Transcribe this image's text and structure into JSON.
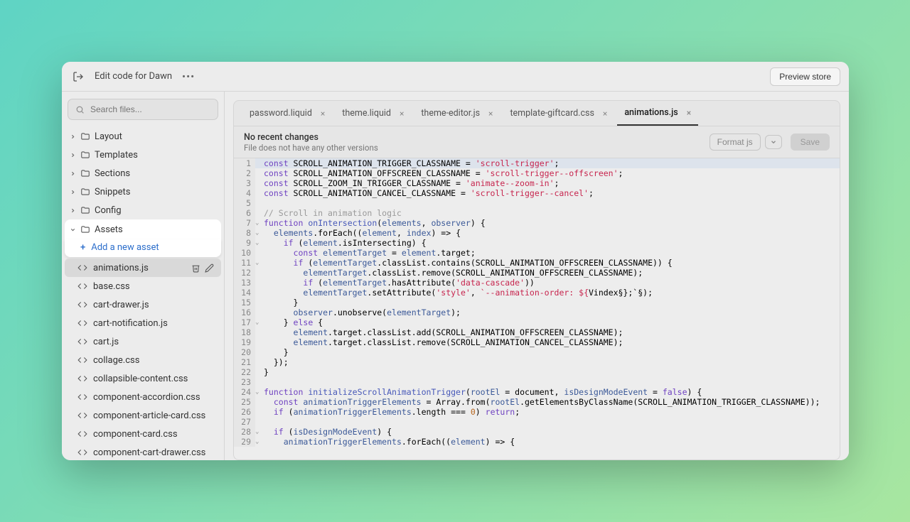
{
  "header": {
    "title": "Edit code for Dawn",
    "preview_label": "Preview store"
  },
  "search": {
    "placeholder": "Search files..."
  },
  "sidebar": {
    "folders": [
      {
        "name": "Layout",
        "expanded": false
      },
      {
        "name": "Templates",
        "expanded": false
      },
      {
        "name": "Sections",
        "expanded": false
      },
      {
        "name": "Snippets",
        "expanded": false
      },
      {
        "name": "Config",
        "expanded": false
      }
    ],
    "assets_label": "Assets",
    "add_asset_label": "Add a new asset",
    "files": [
      {
        "name": "animations.js",
        "selected": true
      },
      {
        "name": "base.css"
      },
      {
        "name": "cart-drawer.js"
      },
      {
        "name": "cart-notification.js"
      },
      {
        "name": "cart.js"
      },
      {
        "name": "collage.css"
      },
      {
        "name": "collapsible-content.css"
      },
      {
        "name": "component-accordion.css"
      },
      {
        "name": "component-article-card.css"
      },
      {
        "name": "component-card.css"
      },
      {
        "name": "component-cart-drawer.css"
      }
    ]
  },
  "tabs": [
    {
      "label": "password.liquid"
    },
    {
      "label": "theme.liquid"
    },
    {
      "label": "theme-editor.js"
    },
    {
      "label": "template-giftcard.css"
    },
    {
      "label": "animations.js",
      "active": true
    }
  ],
  "status": {
    "title": "No recent changes",
    "sub": "File does not have any other versions",
    "format_label": "Format js",
    "save_label": "Save"
  },
  "chart_data": {
    "type": "code",
    "language": "javascript",
    "lines": [
      "const SCROLL_ANIMATION_TRIGGER_CLASSNAME = 'scroll-trigger';",
      "const SCROLL_ANIMATION_OFFSCREEN_CLASSNAME = 'scroll-trigger--offscreen';",
      "const SCROLL_ZOOM_IN_TRIGGER_CLASSNAME = 'animate--zoom-in';",
      "const SCROLL_ANIMATION_CANCEL_CLASSNAME = 'scroll-trigger--cancel';",
      "",
      "// Scroll in animation logic",
      "function onIntersection(elements, observer) {",
      "  elements.forEach((element, index) => {",
      "    if (element.isIntersecting) {",
      "      const elementTarget = element.target;",
      "      if (elementTarget.classList.contains(SCROLL_ANIMATION_OFFSCREEN_CLASSNAME)) {",
      "        elementTarget.classList.remove(SCROLL_ANIMATION_OFFSCREEN_CLASSNAME);",
      "        if (elementTarget.hasAttribute('data-cascade'))",
      "        elementTarget.setAttribute('style', `--animation-order: ${index};`);",
      "      }",
      "      observer.unobserve(elementTarget);",
      "    } else {",
      "      element.target.classList.add(SCROLL_ANIMATION_OFFSCREEN_CLASSNAME);",
      "      element.target.classList.remove(SCROLL_ANIMATION_CANCEL_CLASSNAME);",
      "    }",
      "  });",
      "}",
      "",
      "function initializeScrollAnimationTrigger(rootEl = document, isDesignModeEvent = false) {",
      "  const animationTriggerElements = Array.from(rootEl.getElementsByClassName(SCROLL_ANIMATION_TRIGGER_CLASSNAME));",
      "  if (animationTriggerElements.length === 0) return;",
      "",
      "  if (isDesignModeEvent) {",
      "    animationTriggerElements.forEach((element) => {"
    ]
  }
}
